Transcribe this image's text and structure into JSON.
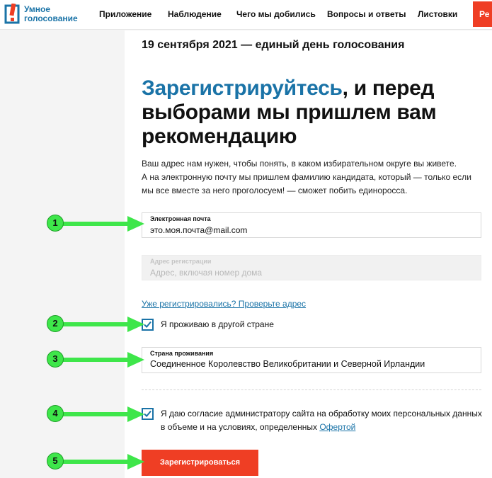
{
  "header": {
    "logo_line1": "Умное",
    "logo_line2": "голосование",
    "nav": [
      "Приложение",
      "Наблюдение",
      "Чего мы добились",
      "Вопросы и ответы",
      "Листовки"
    ],
    "cta_partial": "Ре"
  },
  "page": {
    "date_line": "19 сентября 2021 — единый день голосования",
    "headline_accent": "Зарегистрируйтесь",
    "headline_rest": ", и перед выборами мы пришлем вам рекомендацию",
    "intro_line1": "Ваш адрес нам нужен, чтобы понять, в каком избирательном округе вы живете.",
    "intro_line2": "А на электронную почту мы пришлем фамилию кандидата, который — только если мы все вместе за него проголосуем! — сможет побить единоросса."
  },
  "form": {
    "email_label": "Электронная почта",
    "email_value": "это.моя.почта@mail.com",
    "address_label": "Адрес регистрации",
    "address_placeholder": "Адрес, включая номер дома",
    "already_link": "Уже регистрировались? Проверьте адрес",
    "abroad_label": "Я проживаю в другой стране",
    "abroad_checked": true,
    "country_label": "Страна проживания",
    "country_value": "Соединенное Королевство Великобритании и Северной Ирландии",
    "consent_text": "Я даю согласие администратору сайта на обработку моих персональных данных в объеме и на условиях, определенных",
    "consent_link": "Офертой",
    "consent_checked": true,
    "submit_label": "Зарегистрироваться"
  },
  "annotations": [
    "1",
    "2",
    "3",
    "4",
    "5"
  ],
  "colors": {
    "accent_blue": "#1a73a7",
    "brand_red": "#ef3e24",
    "marker_green": "#3ee64a"
  }
}
